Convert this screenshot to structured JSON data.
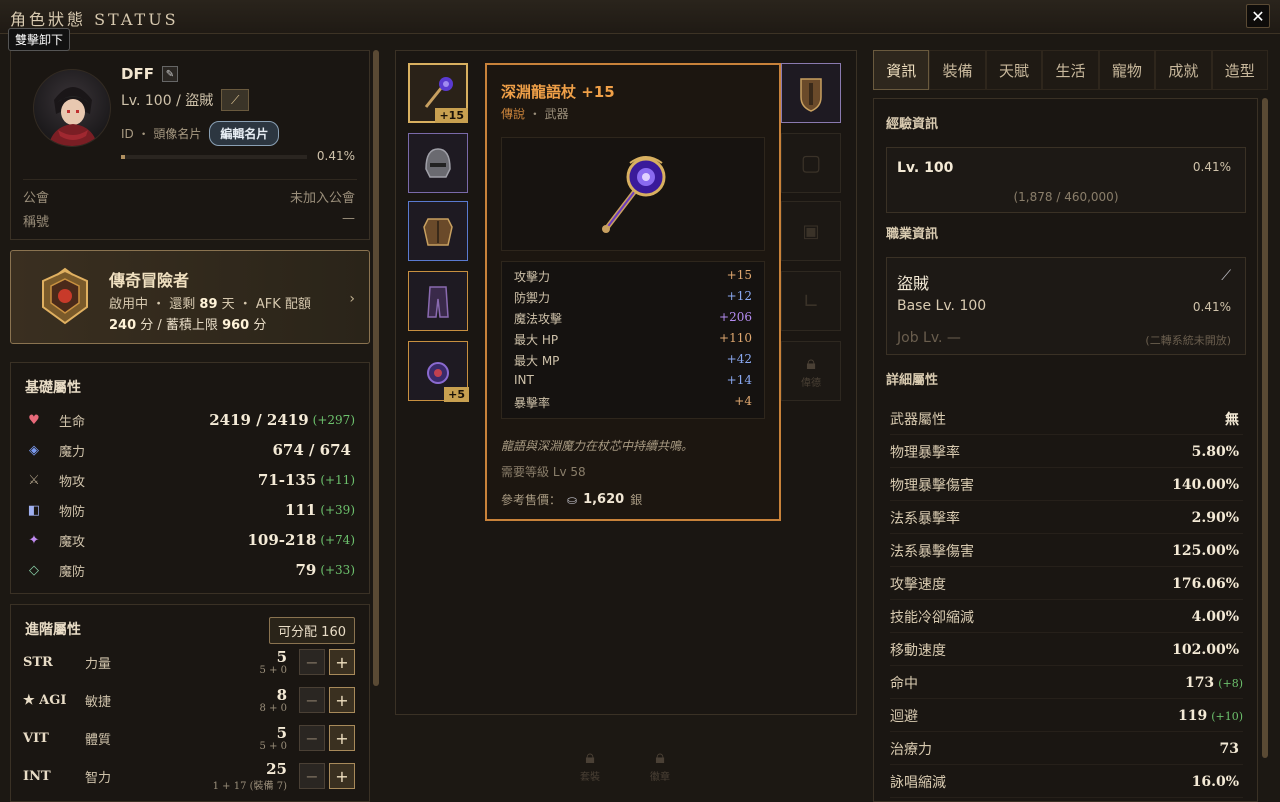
{
  "window": {
    "title": "角色狀態 STATUS",
    "close_glyph": "✕",
    "hint": "雙擊卸下"
  },
  "profile": {
    "name": "DFF",
    "level_class": "Lv. 100 / 盜賊",
    "id_label": "ID ・ 頭像名片",
    "edit_card": "編輯名片",
    "exp_percent": "0.41%",
    "exp_fraction": 0.0041,
    "guild_label": "公會",
    "guild_value": "未加入公會",
    "title_label": "稱號",
    "title_value": "—"
  },
  "legend": {
    "title": "傳奇冒險者",
    "status_prefix": "啟用中 ・ 還剩 ",
    "days": "89",
    "status_suffix": " 天 ・ AFK 配額",
    "score": "240",
    "score_mid": " 分 / 蓄積上限 ",
    "cap": "960",
    "score_suffix": " 分",
    "chevron": "›"
  },
  "basic": {
    "title": "基礎屬性",
    "stats": [
      {
        "icon": "♥",
        "name": "生命",
        "value": "2419 / 2419",
        "bonus": "(+297)",
        "color": "#e86a7a"
      },
      {
        "icon": "◈",
        "name": "魔力",
        "value": "674 / 674",
        "bonus": "",
        "color": "#7a9af0"
      },
      {
        "icon": "⚔",
        "name": "物攻",
        "value": "71-135",
        "bonus": "(+11)",
        "color": "#a89a82"
      },
      {
        "icon": "◧",
        "name": "物防",
        "value": "111",
        "bonus": "(+39)",
        "color": "#a0b0f0"
      },
      {
        "icon": "✦",
        "name": "魔攻",
        "value": "109-218",
        "bonus": "(+74)",
        "color": "#c08af0"
      },
      {
        "icon": "◇",
        "name": "魔防",
        "value": "79",
        "bonus": "(+33)",
        "color": "#8ad0a8"
      }
    ]
  },
  "advanced": {
    "title": "進階屬性",
    "alloc": "可分配 160",
    "rows": [
      {
        "key": "STR",
        "name": "力量",
        "value": "5",
        "sub": "5 + 0"
      },
      {
        "key": "★ AGI",
        "name": "敏捷",
        "value": "8",
        "sub": "8 + 0"
      },
      {
        "key": "VIT",
        "name": "體質",
        "value": "5",
        "sub": "5 + 0"
      },
      {
        "key": "INT",
        "name": "智力",
        "value": "25",
        "sub": "1 + 17 (裝備 7)"
      }
    ],
    "minus": "−",
    "plus": "+"
  },
  "equipment": {
    "slot_badges": [
      "+15",
      "+5"
    ],
    "locked_labels": [
      "套裝",
      "徽章"
    ],
    "side_label": "偉德"
  },
  "tooltip": {
    "name": "深淵龍語杖 +15",
    "rarity": "傳說",
    "sep": " ・ ",
    "kind": "武器",
    "stats": [
      {
        "name": "攻擊力",
        "value": "+15",
        "tone": "gold"
      },
      {
        "name": "防禦力",
        "value": "+12",
        "tone": "blue"
      },
      {
        "name": "魔法攻擊",
        "value": "+206",
        "tone": "purple"
      },
      {
        "name": "最大 HP",
        "value": "+110",
        "tone": "gold"
      },
      {
        "name": "最大 MP",
        "value": "+42",
        "tone": "blue"
      },
      {
        "name": "INT",
        "value": "+14",
        "tone": "blue"
      },
      {
        "name": "暴擊率",
        "value": "+4",
        "tone": "gold"
      }
    ],
    "desc": "龍語與深淵魔力在杖芯中持續共鳴。",
    "req": "需要等級 Lv 58",
    "price_label": "參考售價：",
    "price": "1,620",
    "currency": "銀"
  },
  "tabs": [
    "資訊",
    "裝備",
    "天賦",
    "生活",
    "寵物",
    "成就",
    "造型"
  ],
  "right": {
    "exp_title": "經驗資訊",
    "lv": "Lv. 100",
    "lv_pct": "0.41%",
    "exp_nums": "(1,878 / 460,000)",
    "job_title": "職業資訊",
    "job_name": "盜賊",
    "base_lv": "Base Lv. 100",
    "base_pct": "0.41%",
    "job_lv": "Job Lv. —",
    "job_note": "(二轉系統未開放)",
    "detail_title": "詳細屬性",
    "details": [
      {
        "name": "武器屬性",
        "value": "無",
        "bonus": ""
      },
      {
        "name": "物理暴擊率",
        "value": "5.80%",
        "bonus": ""
      },
      {
        "name": "物理暴擊傷害",
        "value": "140.00%",
        "bonus": ""
      },
      {
        "name": "法系暴擊率",
        "value": "2.90%",
        "bonus": ""
      },
      {
        "name": "法系暴擊傷害",
        "value": "125.00%",
        "bonus": ""
      },
      {
        "name": "攻擊速度",
        "value": "176.06%",
        "bonus": ""
      },
      {
        "name": "技能冷卻縮減",
        "value": "4.00%",
        "bonus": ""
      },
      {
        "name": "移動速度",
        "value": "102.00%",
        "bonus": ""
      },
      {
        "name": "命中",
        "value": "173",
        "bonus": "(+8)"
      },
      {
        "name": "迴避",
        "value": "119",
        "bonus": "(+10)"
      },
      {
        "name": "治療力",
        "value": "73",
        "bonus": ""
      },
      {
        "name": "詠唱縮減",
        "value": "16.0%",
        "bonus": ""
      }
    ]
  },
  "colors": {
    "accent": "#c8823a",
    "gold": "#d8b060",
    "green": "#6cc06c"
  }
}
